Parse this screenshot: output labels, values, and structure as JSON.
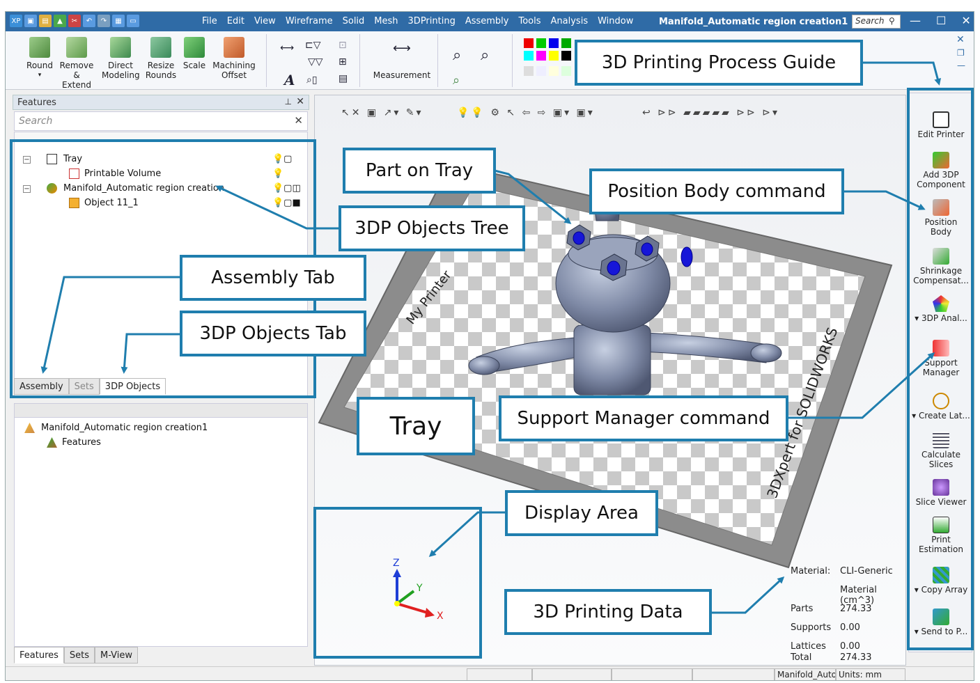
{
  "app": {
    "quick_access_badge": "XP",
    "menu": [
      "File",
      "Edit",
      "View",
      "Wireframe",
      "Solid",
      "Mesh",
      "3DPrinting",
      "Assembly",
      "Tools",
      "Analysis",
      "Window"
    ],
    "doc_title": "Manifold_Automatic region creation1",
    "search_placeholder": "Search"
  },
  "ribbon": {
    "buttons": [
      {
        "label1": "Round",
        "label2": ""
      },
      {
        "label1": "Remove &",
        "label2": "Extend"
      },
      {
        "label1": "Direct",
        "label2": "Modeling"
      },
      {
        "label1": "Resize",
        "label2": "Rounds"
      },
      {
        "label1": "Scale",
        "label2": ""
      },
      {
        "label1": "Machining",
        "label2": "Offset"
      }
    ],
    "measurement_label": "Measurement",
    "colors": {
      "accent": "#1f7eae",
      "titlebar": "#2f6ba6"
    }
  },
  "features_panel": {
    "title": "Features",
    "search_placeholder": "Search",
    "tree": [
      {
        "label": "Tray"
      },
      {
        "label": "Printable Volume"
      },
      {
        "label": "Manifold_Automatic region creation"
      },
      {
        "label": "Object 11_1"
      }
    ],
    "tabs": [
      "Assembly",
      "Sets",
      "3DP Objects"
    ],
    "tree2": [
      {
        "label": "Manifold_Automatic region creation1"
      },
      {
        "label": "Features"
      }
    ],
    "tabs2": [
      "Features",
      "Sets",
      "M-View"
    ]
  },
  "viewport": {
    "tray_label_left": "My Printer",
    "tray_label_right": "3DXpert for SOLIDWORKS",
    "axes": {
      "z": "Z",
      "y": "Y",
      "x": "X"
    }
  },
  "print_data": {
    "rows": [
      {
        "label": "Material:",
        "value": "CLI-Generic"
      },
      {
        "label": "",
        "value": "Material (cm^3)"
      },
      {
        "label": "Parts",
        "value": "274.33"
      },
      {
        "label": "Supports",
        "value": "0.00"
      },
      {
        "label": "Lattices",
        "value": "0.00"
      },
      {
        "label": "Total",
        "value": "274.33"
      }
    ]
  },
  "right_bar": [
    {
      "label1": "Edit Printer",
      "label2": ""
    },
    {
      "label1": "Add 3DP",
      "label2": "Component"
    },
    {
      "label1": "Position",
      "label2": "Body"
    },
    {
      "label1": "Shrinkage",
      "label2": "Compensat..."
    },
    {
      "label1": "▾ 3DP Anal...",
      "label2": ""
    },
    {
      "label1": "Support",
      "label2": "Manager"
    },
    {
      "label1": "▾ Create Lat...",
      "label2": ""
    },
    {
      "label1": "Calculate",
      "label2": "Slices"
    },
    {
      "label1": "Slice Viewer",
      "label2": ""
    },
    {
      "label1": "Print",
      "label2": "Estimation"
    },
    {
      "label1": "▾ Copy Array",
      "label2": ""
    },
    {
      "label1": "▾ Send to P...",
      "label2": ""
    }
  ],
  "status_bar": {
    "doc": "Manifold_Automa",
    "units": "Units: mm"
  },
  "callouts": {
    "process_guide": "3D Printing Process Guide",
    "part_on_tray": "Part on Tray",
    "position_body": "Position Body command",
    "objects_tree": "3DP Objects Tree",
    "assembly_tab": "Assembly Tab",
    "objects_tab": "3DP Objects Tab",
    "tray": "Tray",
    "support_manager": "Support Manager command",
    "display_area": "Display Area",
    "printing_data": "3D Printing Data"
  }
}
